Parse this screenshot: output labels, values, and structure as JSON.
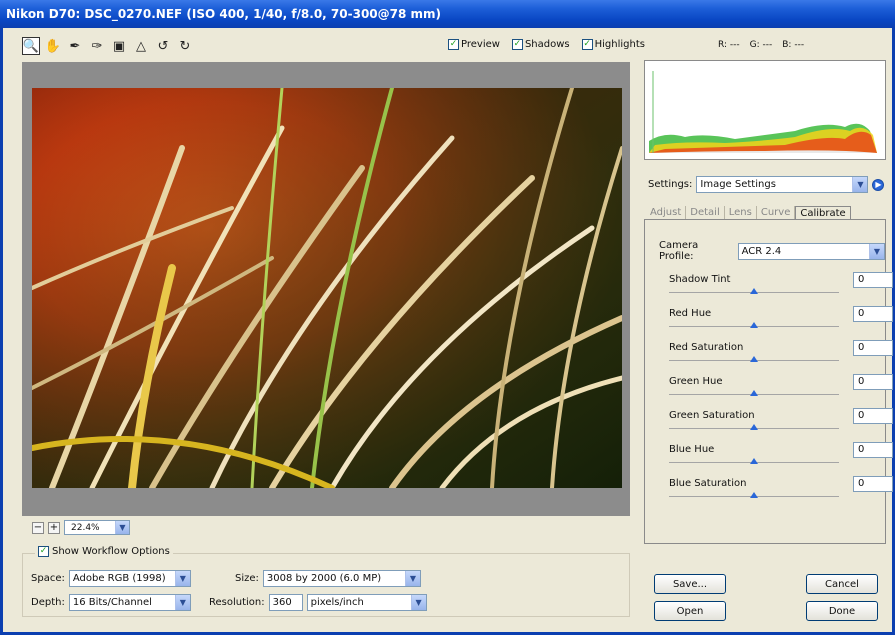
{
  "window": {
    "title": "Nikon D70: DSC_0270.NEF (ISO 400, 1/40, f/8.0, 70-300@78 mm)"
  },
  "toolbar": {
    "tools": [
      "zoom-tool",
      "hand-tool",
      "white-balance-tool",
      "color-sampler-tool",
      "crop-tool",
      "straighten-tool",
      "rotate-left-tool",
      "rotate-right-tool"
    ],
    "preview_label": "Preview",
    "shadows_label": "Shadows",
    "highlights_label": "Highlights",
    "preview_checked": true,
    "shadows_checked": true,
    "highlights_checked": true
  },
  "readout": {
    "r": "R: ---",
    "g": "G: ---",
    "b": "B: ---"
  },
  "zoom": {
    "minus": "−",
    "plus": "+",
    "value": "22.4%"
  },
  "workflow": {
    "show_label": "Show Workflow Options",
    "space_label": "Space:",
    "space_value": "Adobe RGB (1998)",
    "depth_label": "Depth:",
    "depth_value": "16 Bits/Channel",
    "size_label": "Size:",
    "size_value": "3008 by 2000 (6.0 MP)",
    "resolution_label": "Resolution:",
    "resolution_value": "360",
    "resolution_unit": "pixels/inch"
  },
  "settings": {
    "label": "Settings:",
    "value": "Image Settings"
  },
  "tabs": [
    "Adjust",
    "Detail",
    "Lens",
    "Curve",
    "Calibrate"
  ],
  "active_tab": "Calibrate",
  "calibrate": {
    "camera_profile_label": "Camera Profile:",
    "camera_profile_value": "ACR 2.4",
    "sliders": [
      {
        "label": "Shadow Tint",
        "value": "0",
        "level": 0.5
      },
      {
        "label": "Red Hue",
        "value": "0",
        "level": 0.5
      },
      {
        "label": "Red Saturation",
        "value": "0",
        "level": 0.5
      },
      {
        "label": "Green Hue",
        "value": "0",
        "level": 0.5
      },
      {
        "label": "Green Saturation",
        "value": "0",
        "level": 0.5
      },
      {
        "label": "Blue Hue",
        "value": "0",
        "level": 0.5
      },
      {
        "label": "Blue Saturation",
        "value": "0",
        "level": 0.5
      }
    ]
  },
  "buttons": {
    "save": "Save...",
    "cancel": "Cancel",
    "open": "Open",
    "done": "Done"
  },
  "colors": {
    "title_bar": "#0b3fb0",
    "accent": "#2a67d8",
    "check": "#21a121"
  }
}
